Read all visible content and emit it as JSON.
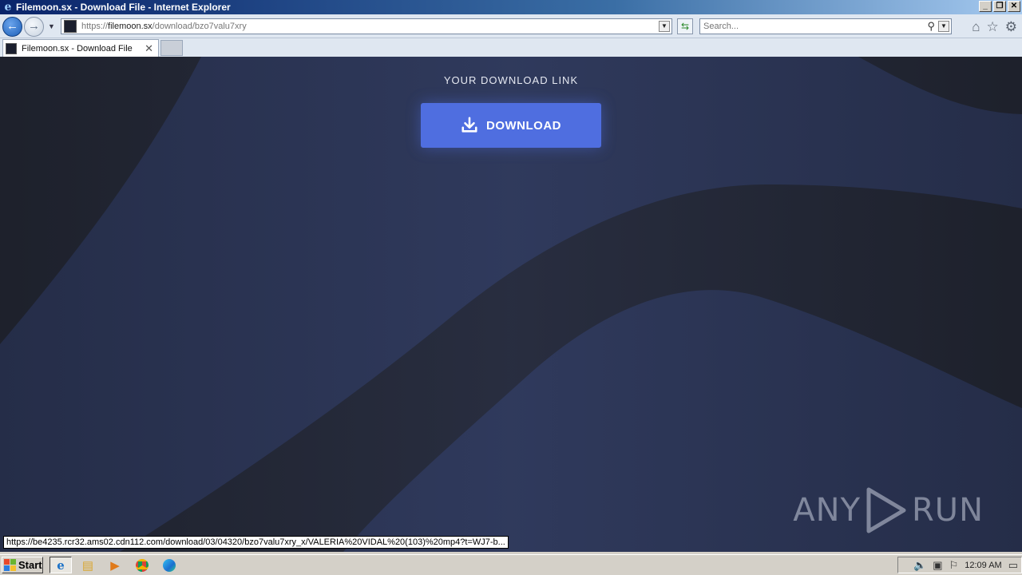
{
  "window": {
    "title": "Filemoon.sx - Download File - Internet Explorer",
    "controls": {
      "minimize": "_",
      "maximize": "❐",
      "close": "✕"
    }
  },
  "address_bar": {
    "url_prefix": "https://",
    "url_host": "filemoon.sx",
    "url_path": "/download/bzo7valu7xry"
  },
  "search": {
    "placeholder": "Search..."
  },
  "tabs": [
    {
      "label": "Filemoon.sx - Download File"
    }
  ],
  "page": {
    "heading": "YOUR DOWNLOAD LINK",
    "download_button": "DOWNLOAD",
    "colors": {
      "background": "#2d3758",
      "wave_dark": "#242835",
      "button": "#4f6ee0"
    }
  },
  "status_bar": {
    "link_preview": "https://be4235.rcr32.ams02.cdn112.com/download/03/04320/bzo7valu7xry_x/VALERIA%20VIDAL%20(103)%20mp4?t=WJ7-b..."
  },
  "watermark": {
    "left": "ANY",
    "right": "RUN"
  },
  "taskbar": {
    "start_label": "Start",
    "clock": "12:09 AM"
  },
  "icons": {
    "back": "back-arrow-icon",
    "forward": "forward-arrow-icon",
    "home": "home-icon",
    "favorites": "star-icon",
    "settings": "gear-icon",
    "search": "search-icon"
  }
}
